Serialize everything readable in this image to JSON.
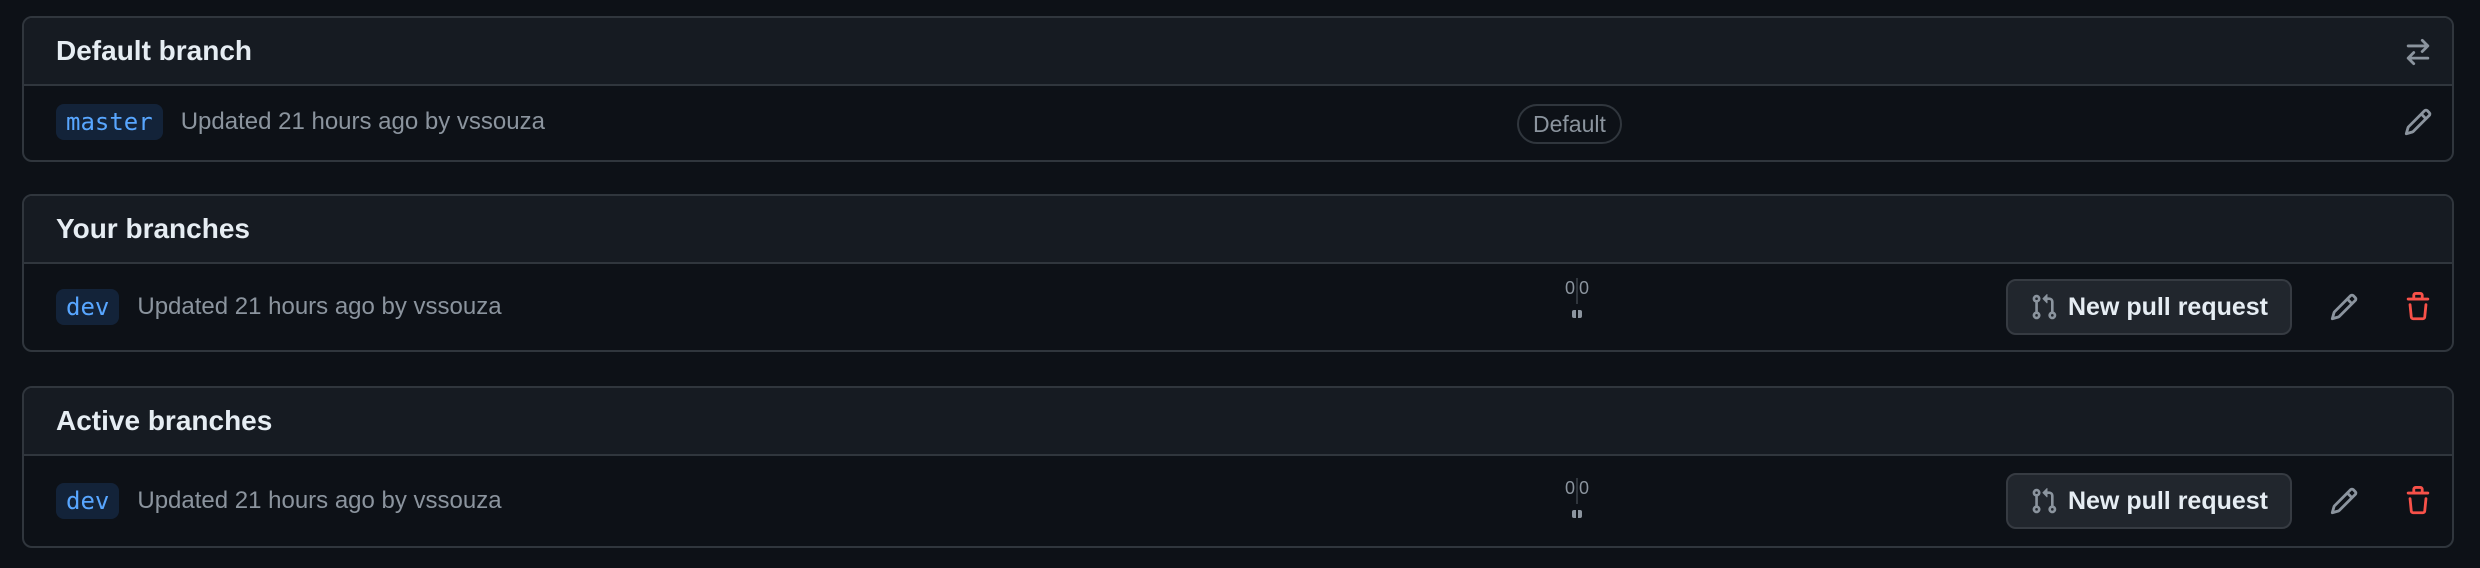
{
  "default_section": {
    "title": "Default branch",
    "icon": "arrow-switch-icon",
    "row": {
      "branch": "master",
      "updated": "Updated 21 hours ago by vssouza",
      "badge": "Default",
      "edit_icon": "pencil-icon"
    }
  },
  "your_section": {
    "title": "Your branches",
    "row": {
      "branch": "dev",
      "updated": "Updated 21 hours ago by vssouza",
      "behind": "0",
      "ahead": "0",
      "pr_label": "New pull request",
      "edit_icon": "pencil-icon",
      "delete_icon": "trash-icon"
    }
  },
  "active_section": {
    "title": "Active branches",
    "row": {
      "branch": "dev",
      "updated": "Updated 21 hours ago by vssouza",
      "behind": "0",
      "ahead": "0",
      "pr_label": "New pull request",
      "edit_icon": "pencil-icon",
      "delete_icon": "trash-icon"
    }
  },
  "colors": {
    "background": "#0d1117",
    "header_bg": "#161b22",
    "border": "#30363d",
    "branch_link": "#58a6ff",
    "muted": "#8b949e",
    "danger": "#f85149"
  }
}
